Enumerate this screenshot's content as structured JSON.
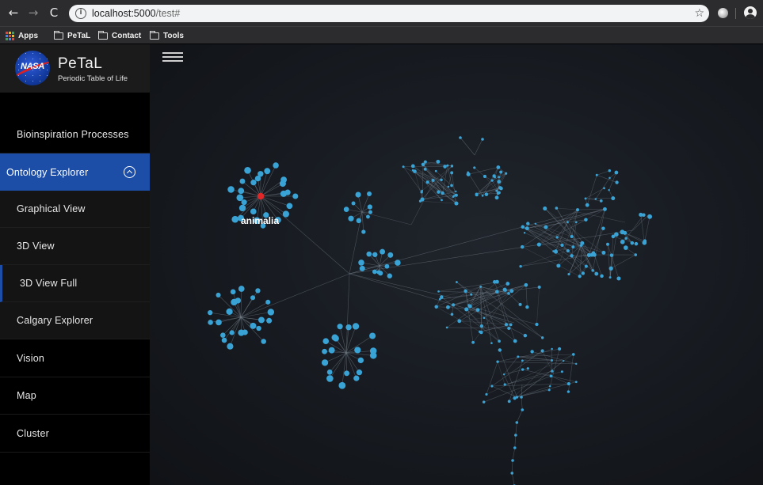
{
  "browser": {
    "url_host": "localhost:5000",
    "url_path": "/test#",
    "bookmarks": [
      {
        "label": "Apps",
        "icon": "apps-grid-icon"
      },
      {
        "label": "PeTaL",
        "icon": "folder-icon"
      },
      {
        "label": "Contact",
        "icon": "folder-icon"
      },
      {
        "label": "Tools",
        "icon": "folder-icon"
      }
    ],
    "icons": {
      "back": "←",
      "forward": "→",
      "reload": "C",
      "info": "i",
      "star": "☆"
    }
  },
  "brand": {
    "logo_text": "NASA",
    "title": "PeTaL",
    "subtitle": "Periodic Table of Life"
  },
  "sidebar": {
    "items": [
      {
        "label": "Bioinspiration Processes"
      },
      {
        "label": "Ontology Explorer"
      },
      {
        "label": "Graphical View"
      },
      {
        "label": "3D View"
      },
      {
        "label": "3D View Full"
      },
      {
        "label": "Calgary Explorer"
      },
      {
        "label": "Vision"
      },
      {
        "label": "Map"
      },
      {
        "label": "Cluster"
      }
    ]
  },
  "graph": {
    "highlighted_node_label": "animalia",
    "colors": {
      "node": "#3aa3d6",
      "edge": "#7a8590",
      "highlight": "#e02828"
    }
  }
}
